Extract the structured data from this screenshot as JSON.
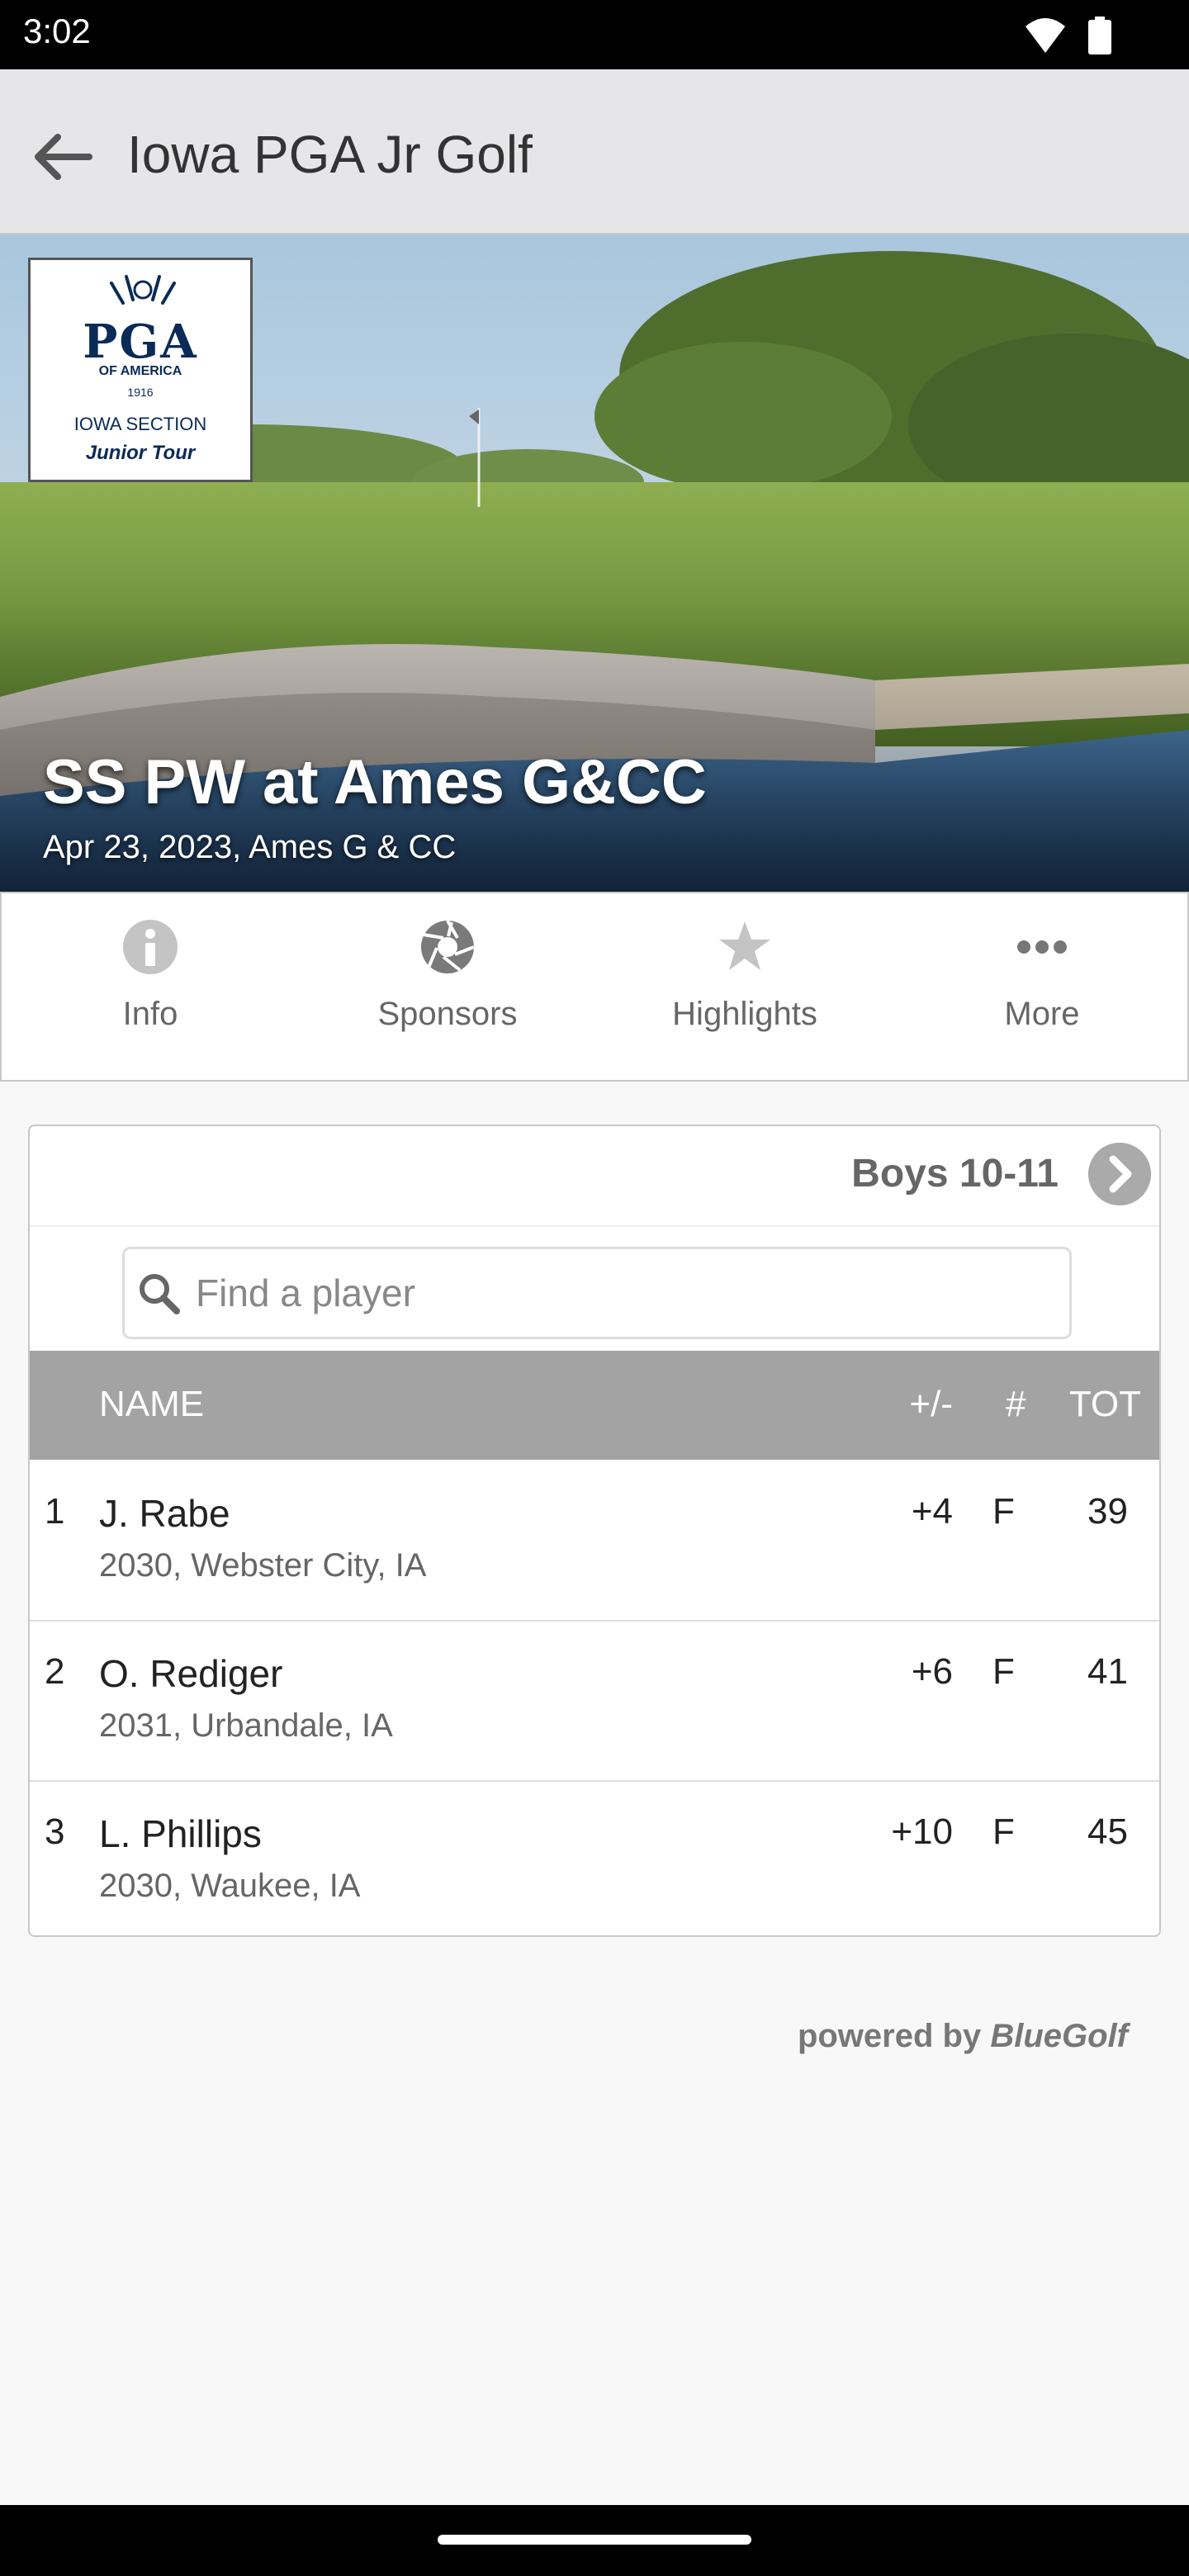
{
  "status": {
    "time": "3:02"
  },
  "app_bar": {
    "title": "Iowa PGA Jr Golf"
  },
  "hero": {
    "logo": {
      "line1": "PGA",
      "line2": "OF AMERICA",
      "line3": "1916",
      "line4": "IOWA SECTION",
      "line5": "Junior Tour"
    },
    "event_title": "SS PW at Ames G&CC",
    "event_subtitle": "Apr 23, 2023, Ames G & CC"
  },
  "tabs": [
    {
      "label": "Info",
      "icon": "info-icon"
    },
    {
      "label": "Sponsors",
      "icon": "aperture-icon"
    },
    {
      "label": "Highlights",
      "icon": "star-icon"
    },
    {
      "label": "More",
      "icon": "more-dots-icon"
    }
  ],
  "leaderboard": {
    "division": "Boys 10-11",
    "search_placeholder": "Find a player",
    "columns": {
      "name": "NAME",
      "par": "+/-",
      "thru": "#",
      "total": "TOT"
    },
    "rows": [
      {
        "pos": "1",
        "name": "J. Rabe",
        "meta": "2030, Webster City, IA",
        "par": "+4",
        "thru": "F",
        "total": "39"
      },
      {
        "pos": "2",
        "name": "O. Rediger",
        "meta": "2031, Urbandale, IA",
        "par": "+6",
        "thru": "F",
        "total": "41"
      },
      {
        "pos": "3",
        "name": "L. Phillips",
        "meta": "2030, Waukee, IA",
        "par": "+10",
        "thru": "F",
        "total": "45"
      }
    ]
  },
  "footer": {
    "powered_prefix": "powered by",
    "powered_brand": "BlueGolf"
  },
  "colors": {
    "header_bg": "#a3a3a3",
    "app_bar_bg": "#e6e6e8",
    "logo_navy": "#0a2a57"
  }
}
